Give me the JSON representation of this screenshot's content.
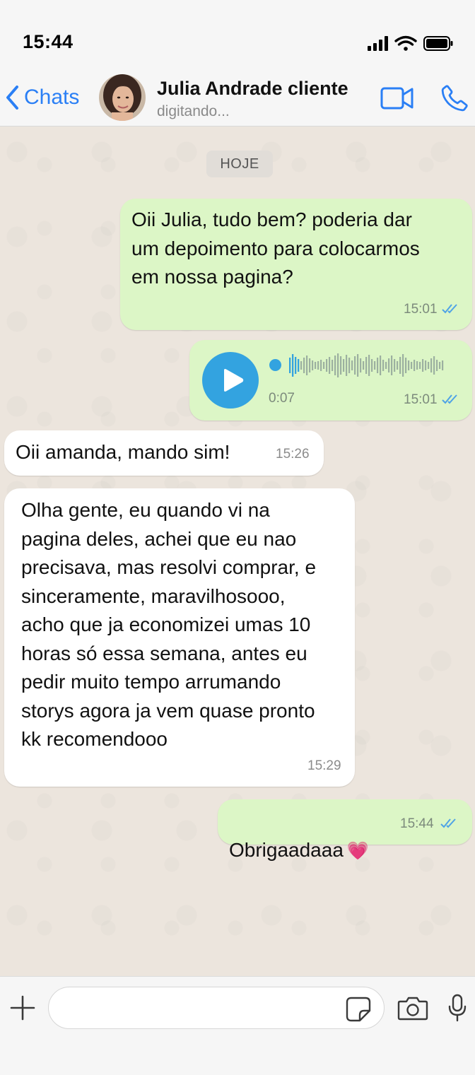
{
  "status_bar": {
    "time": "15:44"
  },
  "header": {
    "back_label": "Chats",
    "contact_name": "Julia Andrade cliente",
    "contact_status": "digitando..."
  },
  "chat": {
    "date_label": "HOJE",
    "messages": [
      {
        "direction": "outgoing",
        "type": "text",
        "text": "Oii Julia, tudo bem? poderia dar\num depoimento para colocarmos\nem nossa pagina?",
        "time": "15:01",
        "status": "read"
      },
      {
        "direction": "outgoing",
        "type": "audio",
        "duration": "0:07",
        "time": "15:01",
        "status": "read"
      },
      {
        "direction": "incoming",
        "type": "text",
        "text": "Oii amanda, mando sim!",
        "time": "15:26"
      },
      {
        "direction": "incoming",
        "type": "text",
        "text": "Olha gente, eu quando vi na\npagina deles, achei que eu nao\nprecisava, mas resolvi comprar, e\nsinceramente, maravilhosooo,\nacho que ja economizei umas 10\nhoras só essa semana, antes eu\npedir muito tempo arrumando\nstorys agora ja vem quase pronto\nkk recomendooo",
        "time": "15:29"
      },
      {
        "direction": "outgoing",
        "type": "text",
        "text": "Obrigaadaaa",
        "emoji": "💗",
        "time": "15:44",
        "status": "read"
      }
    ]
  },
  "input_bar": {
    "placeholder": "",
    "value": ""
  },
  "icons": [
    "back-chevron-icon",
    "video-call-icon",
    "phone-icon",
    "plus-icon",
    "sticker-icon",
    "camera-icon",
    "microphone-icon",
    "play-icon",
    "read-ticks-icon"
  ],
  "colors": {
    "accent": "#2a7ff5",
    "outgoing_bubble": "#dcf6c6",
    "incoming_bubble": "#ffffff",
    "chat_background": "#ece5dd",
    "read_ticks": "#4fa3e6",
    "audio_accent": "#33a3e0"
  }
}
